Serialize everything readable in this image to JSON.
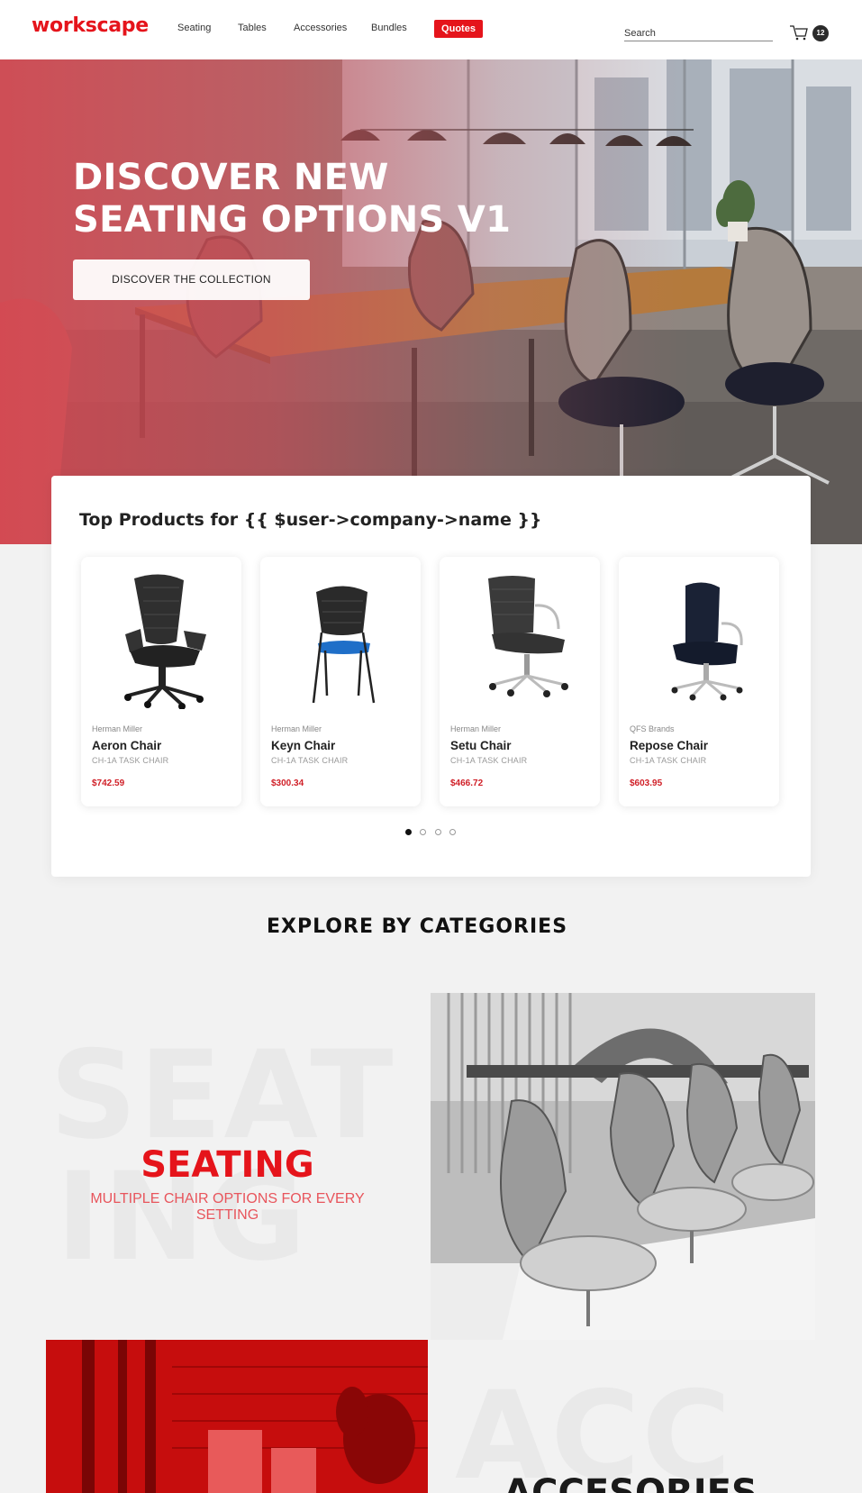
{
  "header": {
    "logo": "workscape",
    "nav": [
      "Seating",
      "Tables",
      "Accessories",
      "Bundles"
    ],
    "quotes_label": "Quotes",
    "search_placeholder": "Search",
    "cart_count": "12",
    "brand_color": "#e5141b"
  },
  "hero": {
    "title_line1": "DISCOVER NEW",
    "title_line2": "SEATING OPTIONS V1",
    "cta_label": "DISCOVER THE COLLECTION"
  },
  "top_products": {
    "title": "Top Products for {{ $user->company->name }}",
    "products": [
      {
        "brand": "Herman Miller",
        "name": "Aeron Chair",
        "subtitle": "CH-1A TASK CHAIR",
        "price": "$742.59"
      },
      {
        "brand": "Herman Miller",
        "name": "Keyn Chair",
        "subtitle": "CH-1A TASK CHAIR",
        "price": "$300.34"
      },
      {
        "brand": "Herman Miller",
        "name": "Setu Chair",
        "subtitle": "CH-1A TASK CHAIR",
        "price": "$466.72"
      },
      {
        "brand": "QFS Brands",
        "name": "Repose Chair",
        "subtitle": "CH-1A TASK CHAIR",
        "price": "$603.95"
      }
    ],
    "pagination": {
      "total": 4,
      "active_index": 0
    }
  },
  "explore": {
    "title": "EXPLORE BY CATEGORIES",
    "categories": [
      {
        "bg_text_line1": "SEAT",
        "bg_text_line2": "ING",
        "title": "SEATING",
        "subtitle": "MULTIPLE CHAIR OPTIONS FOR EVERY SETTING"
      },
      {
        "bg_text_line1": "ACC",
        "title": "ACCESORIES"
      }
    ]
  },
  "icons": {
    "cart": "cart-icon",
    "chairs": [
      "aeron-chair-image",
      "keyn-chair-image",
      "setu-chair-image",
      "repose-chair-image"
    ]
  }
}
